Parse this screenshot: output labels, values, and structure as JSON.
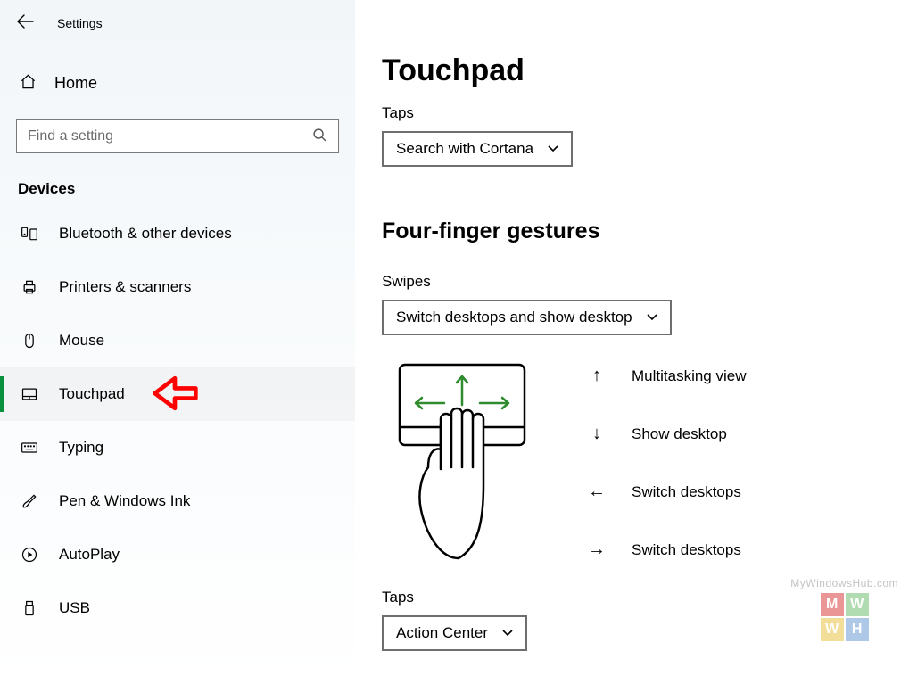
{
  "app_title": "Settings",
  "home_label": "Home",
  "search": {
    "placeholder": "Find a setting"
  },
  "category_heading": "Devices",
  "sidebar": {
    "items": [
      {
        "label": "Bluetooth & other devices"
      },
      {
        "label": "Printers & scanners"
      },
      {
        "label": "Mouse"
      },
      {
        "label": "Touchpad"
      },
      {
        "label": "Typing"
      },
      {
        "label": "Pen & Windows Ink"
      },
      {
        "label": "AutoPlay"
      },
      {
        "label": "USB"
      }
    ]
  },
  "main": {
    "page_title": "Touchpad",
    "taps1": {
      "label": "Taps",
      "value": "Search with Cortana"
    },
    "section_heading": "Four-finger gestures",
    "swipes": {
      "label": "Swipes",
      "value": "Switch desktops and show desktop"
    },
    "legend": {
      "up": "Multitasking view",
      "down": "Show desktop",
      "left": "Switch desktops",
      "right": "Switch desktops"
    },
    "taps2": {
      "label": "Taps",
      "value": "Action Center"
    }
  },
  "watermark": {
    "text": "MyWindowsHub.com",
    "letters": [
      "M",
      "W",
      "W",
      "H"
    ]
  }
}
